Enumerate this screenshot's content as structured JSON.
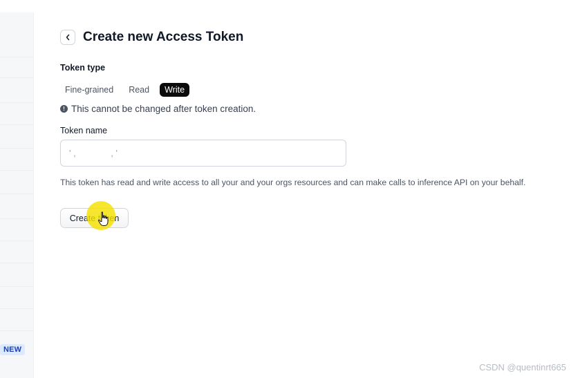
{
  "sidebar": {
    "badge": "NEW"
  },
  "header": {
    "title": "Create new Access Token"
  },
  "token_type": {
    "label": "Token type",
    "options": [
      {
        "label": "Fine-grained",
        "selected": false
      },
      {
        "label": "Read",
        "selected": false
      },
      {
        "label": "Write",
        "selected": true
      }
    ],
    "note": "This cannot be changed after token creation."
  },
  "token_name": {
    "label": "Token name",
    "value": "' ,              , '"
  },
  "description": "This token has read and write access to all your and your orgs resources and can make calls to inference API on your behalf.",
  "actions": {
    "create_label": "Create token"
  },
  "watermark": "CSDN @quentinrt665"
}
